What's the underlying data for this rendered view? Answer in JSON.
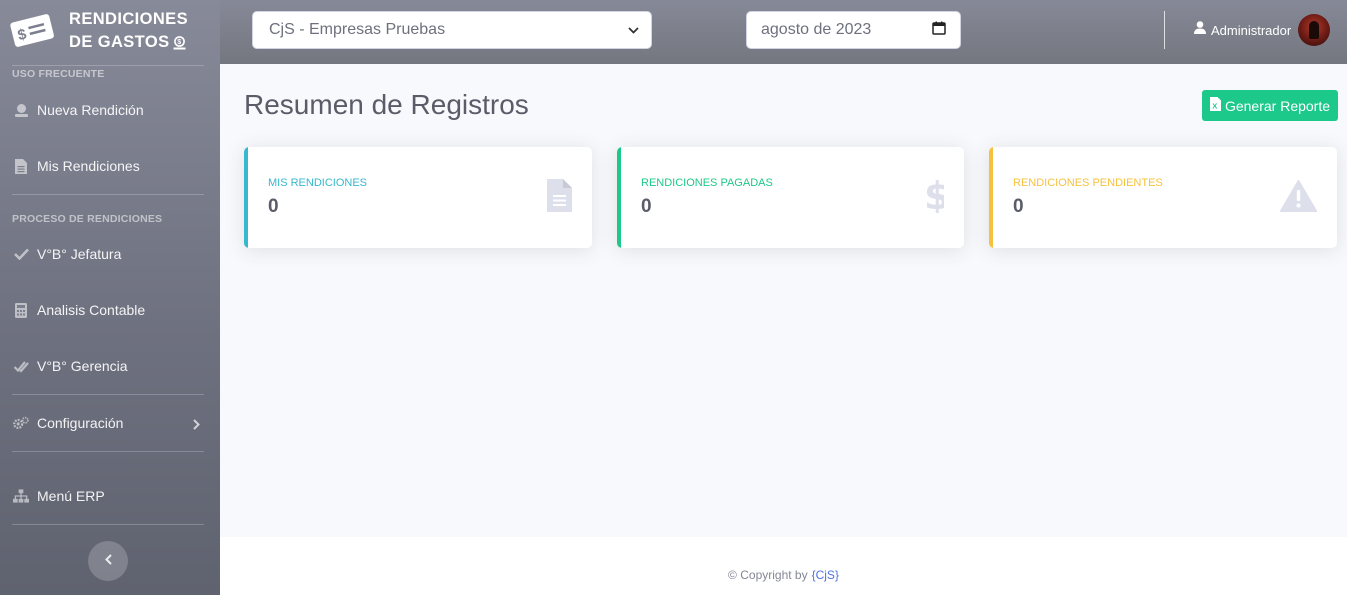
{
  "brand": {
    "line1": "RENDICIONES",
    "line2": "DE GASTOS",
    "icon": "receipt-dollar-icon"
  },
  "sidebar": {
    "section_frequent": "USO FRECUENTE",
    "section_process": "PROCESO DE RENDICIONES",
    "items": [
      {
        "label": "Nueva Rendición",
        "icon": "user-coin-icon"
      },
      {
        "label": "Mis Rendiciones",
        "icon": "file-icon"
      },
      {
        "label": "V°B° Jefatura",
        "icon": "check-icon"
      },
      {
        "label": "Analisis Contable",
        "icon": "calculator-icon"
      },
      {
        "label": "V°B° Gerencia",
        "icon": "double-check-icon"
      },
      {
        "label": "Configuración",
        "icon": "gears-icon"
      },
      {
        "label": "Menú ERP",
        "icon": "sitemap-icon"
      }
    ]
  },
  "topbar": {
    "company_selected": "CjS - Empresas Pruebas",
    "date_value": "agosto de 2023",
    "user_name": "Administrador"
  },
  "main": {
    "title": "Resumen de Registros",
    "report_button": "Generar Reporte",
    "cards": [
      {
        "label": "MIS RENDICIONES",
        "value": "0",
        "color": "#36b9cc",
        "icon": "file-icon"
      },
      {
        "label": "RENDICIONES PAGADAS",
        "value": "0",
        "color": "#1cc88a",
        "icon": "dollar-icon"
      },
      {
        "label": "RENDICIONES PENDIENTES",
        "value": "0",
        "color": "#f6c23e",
        "icon": "warning-icon"
      }
    ]
  },
  "footer": {
    "text": "© Copyright by",
    "link": "{CjS}"
  }
}
